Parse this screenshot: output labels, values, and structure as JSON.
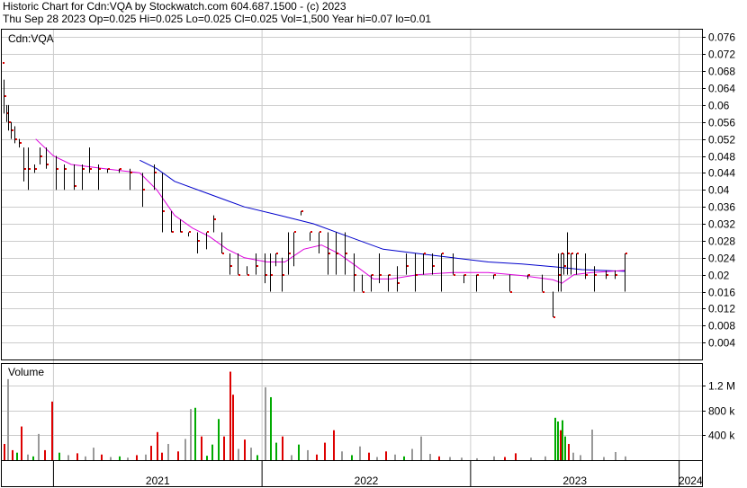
{
  "header": {
    "line1": "Historic Chart for Cdn:VQA by Stockwatch.com 604.687.1500 - (c) 2023",
    "line2": "Thu Sep 28 2023  Op=0.025  Hi=0.025  Lo=0.025  Cl=0.025  Vol=1,500  Year hi=0.07  lo=0.01"
  },
  "chart_data": {
    "type": "ohlc",
    "symbol_label": "Cdn:VQA",
    "price_axis": {
      "ticks": [
        "0.004",
        "0.008",
        "0.012",
        "0.016",
        "0.02",
        "0.024",
        "0.028",
        "0.032",
        "0.036",
        "0.04",
        "0.044",
        "0.048",
        "0.052",
        "0.056",
        "0.06",
        "0.064",
        "0.068",
        "0.072",
        "0.076"
      ],
      "range": [
        0.0,
        0.078
      ]
    },
    "volume_axis": {
      "label": "Volume",
      "ticks": [
        "400 k",
        "800 k",
        "1.2 M"
      ],
      "tick_values": [
        400000,
        800000,
        1200000
      ],
      "range": [
        0,
        1500000
      ]
    },
    "x_axis": {
      "labels": [
        "2021",
        "2022",
        "2023",
        "2024"
      ],
      "start": "2020-10-01",
      "end": "2024-02-10",
      "year_boundaries": [
        "2021-01-01",
        "2022-01-01",
        "2023-01-01",
        "2024-01-01"
      ]
    },
    "colors": {
      "up_volume": "#00aa00",
      "down_volume": "#dd0000",
      "flat_volume": "#999999",
      "price_bar": "#000000",
      "close_tick": "#dd0000",
      "ma_fast": "#dd00dd",
      "ma_slow": "#0000cc",
      "grid": "#cccccc"
    },
    "price_series": [
      {
        "date": "2020-10-03",
        "c": 0.07
      },
      {
        "date": "2020-10-06",
        "h": 0.066,
        "l": 0.058,
        "c": 0.062
      },
      {
        "date": "2020-10-10",
        "h": 0.06,
        "l": 0.056,
        "c": 0.058
      },
      {
        "date": "2020-10-14",
        "h": 0.06,
        "l": 0.054,
        "c": 0.056
      },
      {
        "date": "2020-10-18",
        "h": 0.056,
        "l": 0.052,
        "c": 0.054
      },
      {
        "date": "2020-10-24",
        "h": 0.055,
        "l": 0.051,
        "c": 0.052
      },
      {
        "date": "2020-11-02",
        "h": 0.052,
        "l": 0.05,
        "c": 0.051
      },
      {
        "date": "2020-11-10",
        "h": 0.05,
        "l": 0.042,
        "c": 0.045
      },
      {
        "date": "2020-11-18",
        "h": 0.05,
        "l": 0.04,
        "c": 0.045
      },
      {
        "date": "2020-11-28",
        "h": 0.046,
        "l": 0.044,
        "c": 0.045
      },
      {
        "date": "2020-12-08",
        "h": 0.05,
        "l": 0.046,
        "c": 0.048
      },
      {
        "date": "2020-12-18",
        "h": 0.05,
        "l": 0.045,
        "c": 0.046
      },
      {
        "date": "2021-01-05",
        "h": 0.048,
        "l": 0.04,
        "c": 0.045
      },
      {
        "date": "2021-01-20",
        "h": 0.046,
        "l": 0.04,
        "c": 0.045
      },
      {
        "date": "2021-02-05",
        "h": 0.046,
        "l": 0.04,
        "c": 0.041
      },
      {
        "date": "2021-02-20",
        "h": 0.046,
        "l": 0.04,
        "c": 0.045
      },
      {
        "date": "2021-03-05",
        "h": 0.05,
        "l": 0.044,
        "c": 0.045
      },
      {
        "date": "2021-03-20",
        "h": 0.046,
        "l": 0.04,
        "c": 0.045
      },
      {
        "date": "2021-04-05",
        "h": 0.045,
        "l": 0.044,
        "c": 0.045
      },
      {
        "date": "2021-04-25",
        "h": 0.045,
        "l": 0.044,
        "c": 0.045
      },
      {
        "date": "2021-05-15",
        "h": 0.045,
        "l": 0.04,
        "c": 0.044
      },
      {
        "date": "2021-06-05",
        "h": 0.044,
        "l": 0.036,
        "c": 0.04
      },
      {
        "date": "2021-06-25",
        "h": 0.046,
        "l": 0.04,
        "c": 0.044
      },
      {
        "date": "2021-07-10",
        "h": 0.044,
        "l": 0.03,
        "c": 0.035
      },
      {
        "date": "2021-07-25",
        "h": 0.035,
        "l": 0.03,
        "c": 0.03
      },
      {
        "date": "2021-08-10",
        "h": 0.033,
        "l": 0.03,
        "c": 0.03
      },
      {
        "date": "2021-08-25",
        "h": 0.03,
        "l": 0.029,
        "c": 0.03
      },
      {
        "date": "2021-09-10",
        "h": 0.03,
        "l": 0.025,
        "c": 0.028
      },
      {
        "date": "2021-09-25",
        "h": 0.03,
        "l": 0.026,
        "c": 0.03
      },
      {
        "date": "2021-10-08",
        "h": 0.034,
        "l": 0.03,
        "c": 0.033
      },
      {
        "date": "2021-10-22",
        "h": 0.03,
        "l": 0.025,
        "c": 0.025
      },
      {
        "date": "2021-11-05",
        "h": 0.025,
        "l": 0.02,
        "c": 0.022
      },
      {
        "date": "2021-11-20",
        "h": 0.025,
        "l": 0.02,
        "c": 0.02
      },
      {
        "date": "2021-12-05",
        "h": 0.022,
        "l": 0.02,
        "c": 0.02
      },
      {
        "date": "2021-12-20",
        "h": 0.025,
        "l": 0.02,
        "c": 0.022
      },
      {
        "date": "2022-01-05",
        "h": 0.025,
        "l": 0.018,
        "c": 0.02
      },
      {
        "date": "2022-01-15",
        "h": 0.025,
        "l": 0.016,
        "c": 0.02
      },
      {
        "date": "2022-01-25",
        "h": 0.025,
        "l": 0.022,
        "c": 0.025
      },
      {
        "date": "2022-02-05",
        "h": 0.024,
        "l": 0.016,
        "c": 0.02
      },
      {
        "date": "2022-02-15",
        "h": 0.03,
        "l": 0.02,
        "c": 0.025
      },
      {
        "date": "2022-02-25",
        "h": 0.03,
        "l": 0.022,
        "c": 0.03
      },
      {
        "date": "2022-03-10",
        "h": 0.035,
        "l": 0.034,
        "c": 0.035
      },
      {
        "date": "2022-03-25",
        "h": 0.03,
        "l": 0.028,
        "c": 0.03
      },
      {
        "date": "2022-04-10",
        "h": 0.03,
        "l": 0.025,
        "c": 0.03
      },
      {
        "date": "2022-04-25",
        "h": 0.03,
        "l": 0.02,
        "c": 0.025
      },
      {
        "date": "2022-05-10",
        "h": 0.03,
        "l": 0.02,
        "c": 0.025
      },
      {
        "date": "2022-05-25",
        "h": 0.03,
        "l": 0.02,
        "c": 0.025
      },
      {
        "date": "2022-06-10",
        "h": 0.025,
        "l": 0.016,
        "c": 0.02
      },
      {
        "date": "2022-06-25",
        "h": 0.02,
        "l": 0.016,
        "c": 0.016
      },
      {
        "date": "2022-07-10",
        "h": 0.02,
        "l": 0.016,
        "c": 0.02
      },
      {
        "date": "2022-07-25",
        "h": 0.025,
        "l": 0.018,
        "c": 0.02
      },
      {
        "date": "2022-08-10",
        "h": 0.02,
        "l": 0.016,
        "c": 0.02
      },
      {
        "date": "2022-08-25",
        "h": 0.022,
        "l": 0.016,
        "c": 0.018
      },
      {
        "date": "2022-09-10",
        "h": 0.025,
        "l": 0.02,
        "c": 0.022
      },
      {
        "date": "2022-09-25",
        "h": 0.025,
        "l": 0.016,
        "c": 0.02
      },
      {
        "date": "2022-10-10",
        "h": 0.025,
        "l": 0.02,
        "c": 0.025
      },
      {
        "date": "2022-10-25",
        "h": 0.025,
        "l": 0.02,
        "c": 0.022
      },
      {
        "date": "2022-11-10",
        "h": 0.025,
        "l": 0.016,
        "c": 0.025
      },
      {
        "date": "2022-12-01",
        "h": 0.025,
        "l": 0.02,
        "c": 0.02
      },
      {
        "date": "2022-12-20",
        "h": 0.02,
        "l": 0.018,
        "c": 0.02
      },
      {
        "date": "2023-01-10",
        "h": 0.02,
        "l": 0.016,
        "c": 0.02
      },
      {
        "date": "2023-02-10",
        "h": 0.02,
        "l": 0.019,
        "c": 0.02
      },
      {
        "date": "2023-03-10",
        "h": 0.02,
        "l": 0.016,
        "c": 0.016
      },
      {
        "date": "2023-04-10",
        "h": 0.02,
        "l": 0.019,
        "c": 0.02
      },
      {
        "date": "2023-05-05",
        "h": 0.02,
        "l": 0.016,
        "c": 0.016
      },
      {
        "date": "2023-05-25",
        "h": 0.016,
        "l": 0.01,
        "c": 0.01
      },
      {
        "date": "2023-06-03",
        "h": 0.025,
        "l": 0.016,
        "c": 0.02
      },
      {
        "date": "2023-06-08",
        "h": 0.025,
        "l": 0.016,
        "c": 0.025
      },
      {
        "date": "2023-06-12",
        "h": 0.025,
        "l": 0.02,
        "c": 0.022
      },
      {
        "date": "2023-06-18",
        "h": 0.03,
        "l": 0.02,
        "c": 0.025
      },
      {
        "date": "2023-06-25",
        "h": 0.025,
        "l": 0.02,
        "c": 0.025
      },
      {
        "date": "2023-07-05",
        "h": 0.025,
        "l": 0.02,
        "c": 0.025
      },
      {
        "date": "2023-07-20",
        "h": 0.025,
        "l": 0.019,
        "c": 0.02
      },
      {
        "date": "2023-08-05",
        "h": 0.022,
        "l": 0.016,
        "c": 0.02
      },
      {
        "date": "2023-08-25",
        "h": 0.021,
        "l": 0.019,
        "c": 0.02
      },
      {
        "date": "2023-09-10",
        "h": 0.021,
        "l": 0.019,
        "c": 0.02
      },
      {
        "date": "2023-09-28",
        "h": 0.025,
        "l": 0.016,
        "c": 0.025
      }
    ],
    "ma_fast": [
      {
        "date": "2020-12-01",
        "v": 0.052
      },
      {
        "date": "2021-01-01",
        "v": 0.048
      },
      {
        "date": "2021-02-01",
        "v": 0.046
      },
      {
        "date": "2021-04-01",
        "v": 0.045
      },
      {
        "date": "2021-06-01",
        "v": 0.044
      },
      {
        "date": "2021-07-01",
        "v": 0.04
      },
      {
        "date": "2021-08-01",
        "v": 0.034
      },
      {
        "date": "2021-09-01",
        "v": 0.031
      },
      {
        "date": "2021-10-01",
        "v": 0.029
      },
      {
        "date": "2021-11-01",
        "v": 0.026
      },
      {
        "date": "2021-12-01",
        "v": 0.024
      },
      {
        "date": "2022-01-10",
        "v": 0.023
      },
      {
        "date": "2022-02-10",
        "v": 0.023
      },
      {
        "date": "2022-03-15",
        "v": 0.026
      },
      {
        "date": "2022-04-15",
        "v": 0.027
      },
      {
        "date": "2022-05-15",
        "v": 0.025
      },
      {
        "date": "2022-06-15",
        "v": 0.022
      },
      {
        "date": "2022-07-15",
        "v": 0.019
      },
      {
        "date": "2022-08-15",
        "v": 0.019
      },
      {
        "date": "2022-10-01",
        "v": 0.02
      },
      {
        "date": "2022-12-01",
        "v": 0.0205
      },
      {
        "date": "2023-02-01",
        "v": 0.0205
      },
      {
        "date": "2023-04-01",
        "v": 0.0198
      },
      {
        "date": "2023-05-25",
        "v": 0.0188
      },
      {
        "date": "2023-06-10",
        "v": 0.018
      },
      {
        "date": "2023-07-01",
        "v": 0.02
      },
      {
        "date": "2023-08-01",
        "v": 0.0205
      },
      {
        "date": "2023-09-28",
        "v": 0.021
      }
    ],
    "ma_slow": [
      {
        "date": "2021-06-01",
        "v": 0.047
      },
      {
        "date": "2021-07-01",
        "v": 0.045
      },
      {
        "date": "2021-08-01",
        "v": 0.042
      },
      {
        "date": "2021-10-01",
        "v": 0.039
      },
      {
        "date": "2021-12-01",
        "v": 0.036
      },
      {
        "date": "2022-02-01",
        "v": 0.034
      },
      {
        "date": "2022-04-01",
        "v": 0.032
      },
      {
        "date": "2022-06-01",
        "v": 0.029
      },
      {
        "date": "2022-08-01",
        "v": 0.026
      },
      {
        "date": "2022-10-01",
        "v": 0.025
      },
      {
        "date": "2022-12-01",
        "v": 0.024
      },
      {
        "date": "2023-02-01",
        "v": 0.023
      },
      {
        "date": "2023-04-01",
        "v": 0.0225
      },
      {
        "date": "2023-06-01",
        "v": 0.0218
      },
      {
        "date": "2023-07-15",
        "v": 0.0212
      },
      {
        "date": "2023-09-28",
        "v": 0.0208
      }
    ],
    "volume_series": [
      {
        "date": "2020-10-05",
        "v": 260000,
        "d": "down"
      },
      {
        "date": "2020-10-12",
        "v": 1300000,
        "d": "flat"
      },
      {
        "date": "2020-10-20",
        "v": 160000,
        "d": "down"
      },
      {
        "date": "2020-10-28",
        "v": 120000,
        "d": "up"
      },
      {
        "date": "2020-11-05",
        "v": 540000,
        "d": "down"
      },
      {
        "date": "2020-11-15",
        "v": 90000,
        "d": "flat"
      },
      {
        "date": "2020-11-25",
        "v": 60000,
        "d": "up"
      },
      {
        "date": "2020-12-05",
        "v": 420000,
        "d": "flat"
      },
      {
        "date": "2020-12-15",
        "v": 160000,
        "d": "down"
      },
      {
        "date": "2020-12-28",
        "v": 940000,
        "d": "down"
      },
      {
        "date": "2021-01-10",
        "v": 120000,
        "d": "up"
      },
      {
        "date": "2021-01-25",
        "v": 80000,
        "d": "flat"
      },
      {
        "date": "2021-02-10",
        "v": 110000,
        "d": "down"
      },
      {
        "date": "2021-02-25",
        "v": 60000,
        "d": "flat"
      },
      {
        "date": "2021-03-10",
        "v": 200000,
        "d": "flat"
      },
      {
        "date": "2021-03-25",
        "v": 90000,
        "d": "down"
      },
      {
        "date": "2021-04-10",
        "v": 50000,
        "d": "flat"
      },
      {
        "date": "2021-04-25",
        "v": 60000,
        "d": "up"
      },
      {
        "date": "2021-05-10",
        "v": 40000,
        "d": "flat"
      },
      {
        "date": "2021-05-25",
        "v": 80000,
        "d": "down"
      },
      {
        "date": "2021-06-10",
        "v": 90000,
        "d": "flat"
      },
      {
        "date": "2021-06-20",
        "v": 230000,
        "d": "down"
      },
      {
        "date": "2021-06-30",
        "v": 450000,
        "d": "down"
      },
      {
        "date": "2021-07-08",
        "v": 120000,
        "d": "down"
      },
      {
        "date": "2021-07-20",
        "v": 260000,
        "d": "flat"
      },
      {
        "date": "2021-08-05",
        "v": 140000,
        "d": "down"
      },
      {
        "date": "2021-08-18",
        "v": 340000,
        "d": "flat"
      },
      {
        "date": "2021-08-28",
        "v": 820000,
        "d": "flat"
      },
      {
        "date": "2021-09-05",
        "v": 840000,
        "d": "up"
      },
      {
        "date": "2021-09-15",
        "v": 380000,
        "d": "down"
      },
      {
        "date": "2021-09-25",
        "v": 70000,
        "d": "up"
      },
      {
        "date": "2021-10-05",
        "v": 250000,
        "d": "up"
      },
      {
        "date": "2021-10-15",
        "v": 660000,
        "d": "up"
      },
      {
        "date": "2021-10-25",
        "v": 380000,
        "d": "down"
      },
      {
        "date": "2021-11-05",
        "v": 1420000,
        "d": "down"
      },
      {
        "date": "2021-11-10",
        "v": 1050000,
        "d": "down"
      },
      {
        "date": "2021-11-20",
        "v": 180000,
        "d": "flat"
      },
      {
        "date": "2021-12-01",
        "v": 330000,
        "d": "down"
      },
      {
        "date": "2021-12-12",
        "v": 200000,
        "d": "flat"
      },
      {
        "date": "2021-12-22",
        "v": 80000,
        "d": "up"
      },
      {
        "date": "2022-01-05",
        "v": 1170000,
        "d": "flat"
      },
      {
        "date": "2022-01-15",
        "v": 1010000,
        "d": "up"
      },
      {
        "date": "2022-01-25",
        "v": 280000,
        "d": "up"
      },
      {
        "date": "2022-02-05",
        "v": 380000,
        "d": "down"
      },
      {
        "date": "2022-02-20",
        "v": 80000,
        "d": "flat"
      },
      {
        "date": "2022-03-05",
        "v": 250000,
        "d": "up"
      },
      {
        "date": "2022-03-20",
        "v": 160000,
        "d": "flat"
      },
      {
        "date": "2022-04-05",
        "v": 90000,
        "d": "down"
      },
      {
        "date": "2022-04-20",
        "v": 280000,
        "d": "down"
      },
      {
        "date": "2022-05-05",
        "v": 480000,
        "d": "down"
      },
      {
        "date": "2022-05-20",
        "v": 140000,
        "d": "flat"
      },
      {
        "date": "2022-06-05",
        "v": 80000,
        "d": "up"
      },
      {
        "date": "2022-06-20",
        "v": 220000,
        "d": "flat"
      },
      {
        "date": "2022-07-05",
        "v": 120000,
        "d": "down"
      },
      {
        "date": "2022-07-20",
        "v": 50000,
        "d": "flat"
      },
      {
        "date": "2022-08-05",
        "v": 140000,
        "d": "down"
      },
      {
        "date": "2022-08-20",
        "v": 90000,
        "d": "flat"
      },
      {
        "date": "2022-09-05",
        "v": 60000,
        "d": "up"
      },
      {
        "date": "2022-09-20",
        "v": 180000,
        "d": "flat"
      },
      {
        "date": "2022-10-05",
        "v": 380000,
        "d": "flat"
      },
      {
        "date": "2022-10-20",
        "v": 100000,
        "d": "flat"
      },
      {
        "date": "2022-11-05",
        "v": 60000,
        "d": "down"
      },
      {
        "date": "2022-11-25",
        "v": 50000,
        "d": "flat"
      },
      {
        "date": "2022-12-15",
        "v": 40000,
        "d": "flat"
      },
      {
        "date": "2023-01-10",
        "v": 30000,
        "d": "flat"
      },
      {
        "date": "2023-02-10",
        "v": 60000,
        "d": "flat"
      },
      {
        "date": "2023-03-01",
        "v": 50000,
        "d": "down"
      },
      {
        "date": "2023-03-20",
        "v": 110000,
        "d": "down"
      },
      {
        "date": "2023-04-15",
        "v": 40000,
        "d": "flat"
      },
      {
        "date": "2023-05-10",
        "v": 60000,
        "d": "flat"
      },
      {
        "date": "2023-05-28",
        "v": 680000,
        "d": "up"
      },
      {
        "date": "2023-06-02",
        "v": 620000,
        "d": "up"
      },
      {
        "date": "2023-06-06",
        "v": 480000,
        "d": "down"
      },
      {
        "date": "2023-06-10",
        "v": 640000,
        "d": "up"
      },
      {
        "date": "2023-06-14",
        "v": 380000,
        "d": "up"
      },
      {
        "date": "2023-06-20",
        "v": 260000,
        "d": "down"
      },
      {
        "date": "2023-06-28",
        "v": 120000,
        "d": "flat"
      },
      {
        "date": "2023-07-10",
        "v": 80000,
        "d": "flat"
      },
      {
        "date": "2023-08-01",
        "v": 490000,
        "d": "flat"
      },
      {
        "date": "2023-08-20",
        "v": 50000,
        "d": "flat"
      },
      {
        "date": "2023-09-10",
        "v": 130000,
        "d": "flat"
      },
      {
        "date": "2023-09-28",
        "v": 60000,
        "d": "flat"
      }
    ]
  }
}
